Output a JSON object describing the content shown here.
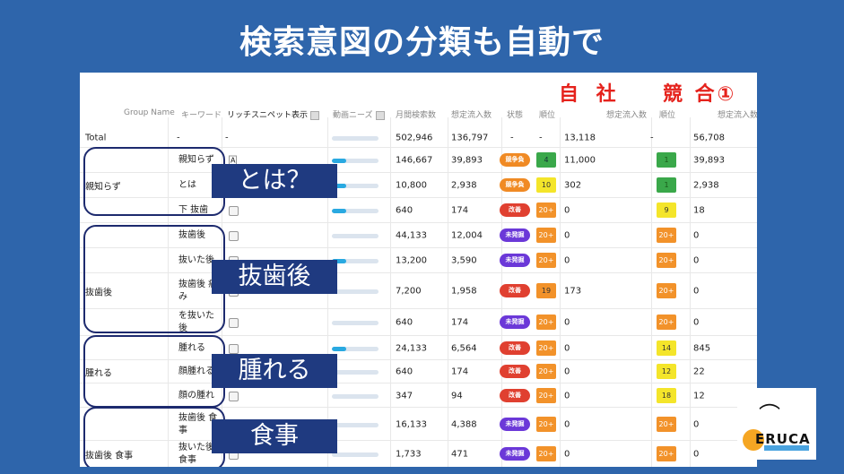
{
  "title": "検索意図の分類も自動で",
  "sections": {
    "own": "自 社",
    "competitor": "競 合①"
  },
  "headers": {
    "group": "Group Name",
    "keyword": "キーワード",
    "snippet": "リッチスニペット表示",
    "need": "動画ニーズ",
    "volume": "月間検索数",
    "traffic": "想定流入数",
    "status": "状態",
    "rank": "順位",
    "traffic2": "想定流入数",
    "rank2": "順位",
    "traffic3": "想定流入数"
  },
  "total": {
    "label": "Total",
    "group": "-",
    "snippet": "-",
    "volume": "502,946",
    "traffic": "136,797",
    "status": "-",
    "rank": "-",
    "own_traffic": "13,118",
    "rank2": "-",
    "comp_traffic": "56,708"
  },
  "rows": [
    {
      "group": "",
      "keyword": "親知らず",
      "snippet": "A",
      "bar": 0.3,
      "volume": "146,667",
      "traffic": "39,893",
      "status": "競争負",
      "rank": "4",
      "own": "11,000",
      "rank2": "1",
      "comp": "39,893"
    },
    {
      "group": "親知らず",
      "keyword": "とは",
      "snippet": "",
      "bar": 0.3,
      "volume": "10,800",
      "traffic": "2,938",
      "status": "競争負",
      "rank": "10",
      "own": "302",
      "rank2": "1",
      "comp": "2,938"
    },
    {
      "group": "",
      "keyword": "下 抜歯",
      "snippet": "",
      "bar": 0.3,
      "volume": "640",
      "traffic": "174",
      "status": "改善",
      "rank": "20+",
      "own": "0",
      "rank2": "9",
      "comp": "18"
    },
    {
      "group": "",
      "keyword": "抜歯後",
      "snippet": "",
      "bar": 0,
      "volume": "44,133",
      "traffic": "12,004",
      "status": "未発掘",
      "rank": "20+",
      "own": "0",
      "rank2": "20+",
      "comp": "0"
    },
    {
      "group": "",
      "keyword": "抜いた後",
      "snippet": "",
      "bar": 0.3,
      "volume": "13,200",
      "traffic": "3,590",
      "status": "未発掘",
      "rank": "20+",
      "own": "0",
      "rank2": "20+",
      "comp": "0"
    },
    {
      "group": "抜歯後",
      "keyword": "抜歯後 痛み",
      "snippet": "",
      "bar": 0,
      "volume": "7,200",
      "traffic": "1,958",
      "status": "改善",
      "rank": "19",
      "own": "173",
      "rank2": "20+",
      "comp": "0"
    },
    {
      "group": "",
      "keyword": "を抜いた後",
      "snippet": "",
      "bar": 0,
      "volume": "640",
      "traffic": "174",
      "status": "未発掘",
      "rank": "20+",
      "own": "0",
      "rank2": "20+",
      "comp": "0"
    },
    {
      "group": "",
      "keyword": "腫れる",
      "snippet": "",
      "bar": 0.3,
      "volume": "24,133",
      "traffic": "6,564",
      "status": "改善",
      "rank": "20+",
      "own": "0",
      "rank2": "14",
      "comp": "845"
    },
    {
      "group": "腫れる",
      "keyword": "顔腫れる",
      "snippet": "",
      "bar": 0,
      "volume": "640",
      "traffic": "174",
      "status": "改善",
      "rank": "20+",
      "own": "0",
      "rank2": "12",
      "comp": "22"
    },
    {
      "group": "",
      "keyword": "顔の腫れ",
      "snippet": "",
      "bar": 0,
      "volume": "347",
      "traffic": "94",
      "status": "改善",
      "rank": "20+",
      "own": "0",
      "rank2": "18",
      "comp": "12"
    },
    {
      "group": "",
      "keyword": "抜歯後 食事",
      "snippet": "",
      "bar": 0,
      "volume": "16,133",
      "traffic": "4,388",
      "status": "未発掘",
      "rank": "20+",
      "own": "0",
      "rank2": "20+",
      "comp": "0"
    },
    {
      "group": "抜歯後 食事",
      "keyword": "抜いた後 食事",
      "snippet": "",
      "bar": 0,
      "volume": "1,733",
      "traffic": "471",
      "status": "未発掘",
      "rank": "20+",
      "own": "0",
      "rank2": "20+",
      "comp": "0"
    }
  ],
  "labels": [
    "とは？",
    "抜歯後",
    "腫れる",
    "食事"
  ],
  "logo": "ERUCA",
  "colors": {
    "background": "#2e65ab",
    "red": "#e5221c",
    "navy": "#1d2a6e",
    "label": "#1f3a80",
    "bar": "#29a9e1",
    "orange": "#f08a24",
    "pill_red": "#e04030",
    "pill_purple": "#6b38d8",
    "green": "#3aa84a",
    "yellow": "#f4e52a",
    "rank_orange": "#f2922a"
  }
}
